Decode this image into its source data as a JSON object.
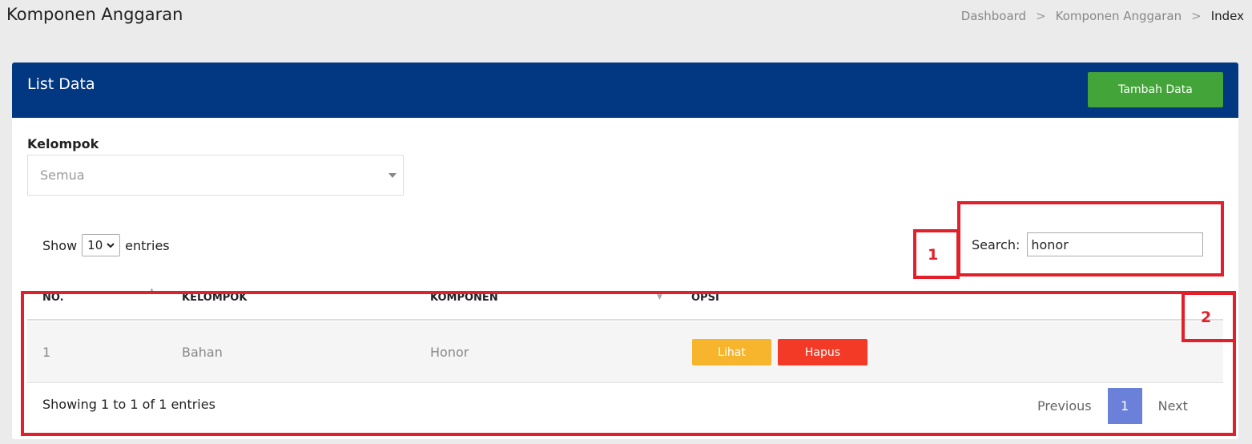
{
  "page": {
    "title": "Komponen Anggaran"
  },
  "breadcrumb": {
    "items": [
      "Dashboard",
      "Komponen Anggaran",
      "Index"
    ],
    "separator": ">"
  },
  "card": {
    "title": "List Data",
    "add_button": "Tambah Data",
    "header_color": "#023781",
    "add_button_color": "#43a43a"
  },
  "filter": {
    "label": "Kelompok",
    "selected": "Semua"
  },
  "entries": {
    "prefix": "Show",
    "value": "10",
    "suffix": "entries"
  },
  "search": {
    "label": "Search:",
    "value": "honor"
  },
  "table": {
    "columns": [
      "NO.",
      "KELOMPOK",
      "KOMPONEN",
      "OPSI"
    ],
    "rows": [
      {
        "no": "1",
        "kelompok": "Bahan",
        "komponen": "Honor",
        "view_label": "Lihat",
        "delete_label": "Hapus"
      }
    ]
  },
  "footer": {
    "info": "Showing 1 to 1 of 1 entries",
    "previous": "Previous",
    "current_page": "1",
    "next": "Next"
  },
  "annotations": {
    "labels": [
      "1",
      "2"
    ],
    "color": "#e2202b"
  }
}
